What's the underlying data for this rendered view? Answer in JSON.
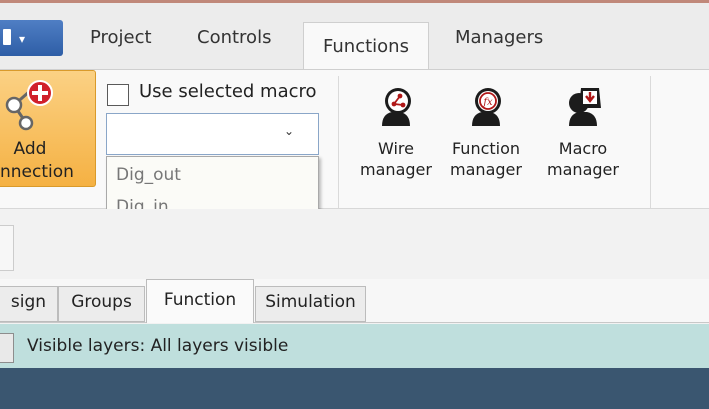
{
  "colors": {
    "app_button": "#3f6fb8",
    "ribbon_bg": "#f9f9f9",
    "add_connection": "#f5b143",
    "layer_bar": "#bfdfdd",
    "bottom_panel": "#3a5670"
  },
  "ribbon_tabs": {
    "project": "Project",
    "controls": "Controls",
    "functions": "Functions",
    "managers": "Managers",
    "active": "Functions"
  },
  "app_button": {
    "icon": "document-icon",
    "caret": "▾"
  },
  "add_connection": {
    "label_line1": "Add",
    "label_line2": "nnection",
    "icon": "add-connection-icon"
  },
  "macro": {
    "checkbox_label": "Use selected macro",
    "checked": false,
    "combo_value": "",
    "dropdown_arrow": "⌄",
    "options": [
      "Dig_out",
      "Dig_in"
    ]
  },
  "managers": [
    {
      "line1": "Wire",
      "line2": "manager",
      "icon": "wire-manager-icon"
    },
    {
      "line1": "Function",
      "line2": "manager",
      "icon": "function-manager-icon"
    },
    {
      "line1": "Macro",
      "line2": "manager",
      "icon": "macro-manager-icon"
    }
  ],
  "view_tabs": {
    "design": "sign",
    "groups": "Groups",
    "function": "Function",
    "simulation": "Simulation",
    "active": "Function"
  },
  "layers": {
    "label": "Visible layers: All layers visible"
  }
}
